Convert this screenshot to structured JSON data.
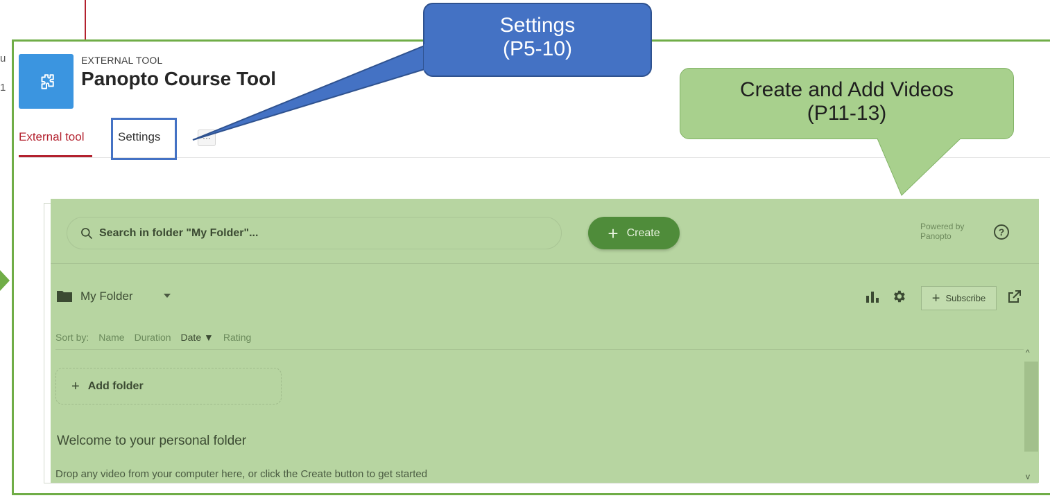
{
  "left_fragments": [
    "u",
    "1"
  ],
  "tool": {
    "eyebrow": "EXTERNAL TOOL",
    "title": "Panopto Course Tool",
    "icon": "puzzle-icon",
    "icon_color": "#3b95e0"
  },
  "tabs": {
    "items": [
      {
        "label": "External tool",
        "active": true
      },
      {
        "label": "Settings",
        "active": false
      }
    ],
    "more_label": "···"
  },
  "panopto": {
    "search": {
      "placeholder": "Search in folder \"My Folder\"..."
    },
    "create_label": "Create",
    "powered_by": [
      "Powered by",
      "Panopto"
    ],
    "help_label": "?",
    "folder_name": "My Folder",
    "subscribe_label": "Subscribe",
    "sort": {
      "label": "Sort by:",
      "options": [
        "Name",
        "Duration",
        "Date",
        "Rating"
      ],
      "active": "Date"
    },
    "add_folder_label": "Add folder",
    "welcome_title": "Welcome to your personal folder",
    "welcome_text": "Drop any video from your computer here, or click the Create button to get started"
  },
  "annotations": {
    "settings_callout": [
      "Settings",
      "(P5-10)"
    ],
    "create_callout": [
      "Create and Add Videos",
      "(P11-13)"
    ]
  },
  "colors": {
    "accent_red": "#b3212e",
    "overlay_green": "#b7d5a1",
    "frame_green": "#70ad47",
    "callout_blue": "#4472c4",
    "create_button": "#4f8c3a"
  }
}
